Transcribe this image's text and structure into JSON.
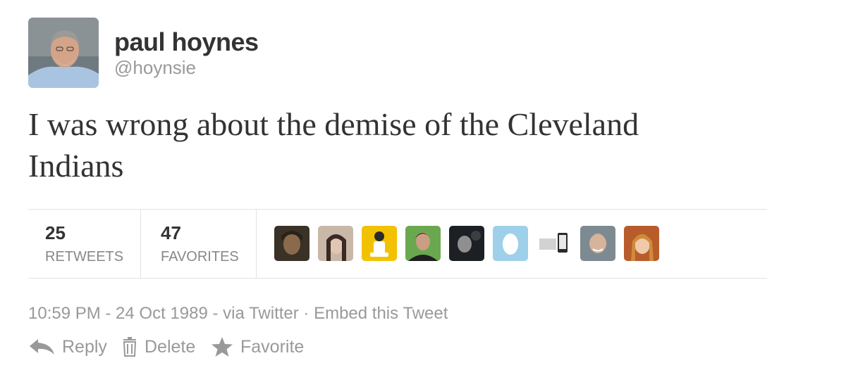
{
  "user": {
    "name": "paul hoynes",
    "handle": "@hoynsie"
  },
  "tweet": {
    "text": "I was wrong about the demise of the Cleveland Indians"
  },
  "stats": {
    "retweets_count": "25",
    "retweets_label": "RETWEETS",
    "favorites_count": "47",
    "favorites_label": "FAVORITES"
  },
  "meta": {
    "time": "10:59 PM - 24 Oct 1989",
    "via_prefix": " - via ",
    "via_source": "Twitter",
    "separator": " · ",
    "embed": "Embed this Tweet"
  },
  "actions": {
    "reply": "Reply",
    "delete": "Delete",
    "favorite": "Favorite"
  },
  "colors": {
    "text": "#333333",
    "muted": "#999999",
    "border": "#e2e2e2"
  }
}
